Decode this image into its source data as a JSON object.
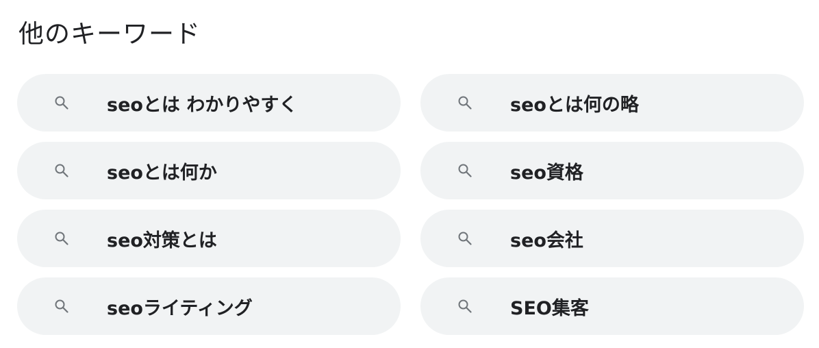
{
  "section": {
    "title": "他のキーワード"
  },
  "keywords": [
    {
      "label": "seoとは わかりやすく",
      "icon": "search-icon"
    },
    {
      "label": "seoとは何の略",
      "icon": "search-icon"
    },
    {
      "label": "seoとは何か",
      "icon": "search-icon"
    },
    {
      "label": "seo資格",
      "icon": "search-icon"
    },
    {
      "label": "seo対策とは",
      "icon": "search-icon"
    },
    {
      "label": "seo会社",
      "icon": "search-icon"
    },
    {
      "label": "seoライティング",
      "icon": "search-icon"
    },
    {
      "label": "SEO集客",
      "icon": "search-icon"
    }
  ],
  "colors": {
    "chip_background": "#f1f3f4",
    "text": "#202124",
    "icon": "#70757a"
  }
}
